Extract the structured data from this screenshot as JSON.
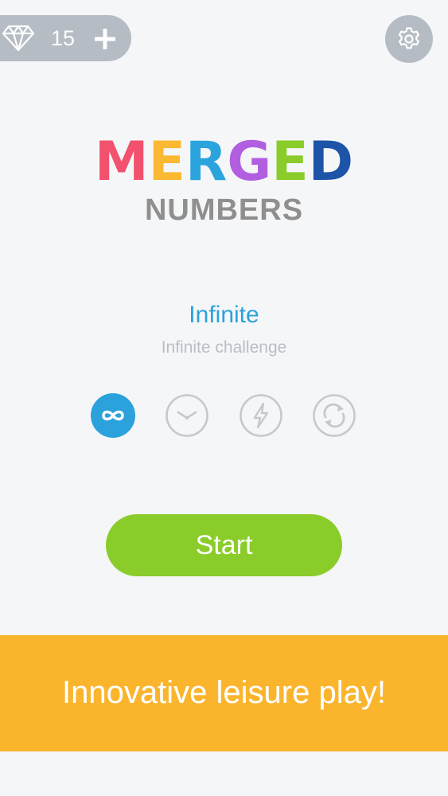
{
  "currency": {
    "icon": "diamond-icon",
    "count": "15",
    "add_icon": "plus-icon"
  },
  "settings": {
    "icon": "gear-icon"
  },
  "logo": {
    "letters": [
      {
        "char": "M",
        "color": "#f2526d"
      },
      {
        "char": "E",
        "color": "#fbb932"
      },
      {
        "char": "R",
        "color": "#2ba4de"
      },
      {
        "char": "G",
        "color": "#b25ee0"
      },
      {
        "char": "E",
        "color": "#8acc2a"
      },
      {
        "char": "D",
        "color": "#1e54a8"
      }
    ],
    "subtitle": "NUMBERS"
  },
  "mode": {
    "title": "Infinite",
    "description": "Infinite challenge",
    "options": [
      {
        "icon": "infinity-icon",
        "selected": true
      },
      {
        "icon": "clock-icon",
        "selected": false
      },
      {
        "icon": "lightning-icon",
        "selected": false
      },
      {
        "icon": "refresh-icon",
        "selected": false
      }
    ]
  },
  "start": {
    "label": "Start"
  },
  "banner": {
    "text": "Innovative leisure play!"
  },
  "colors": {
    "accent": "#2ca2dc",
    "start_green": "#8acc2a",
    "banner_orange": "#fab52d",
    "inactive_gray": "#c4c9cf",
    "pill_gray": "#b6bcc4"
  }
}
